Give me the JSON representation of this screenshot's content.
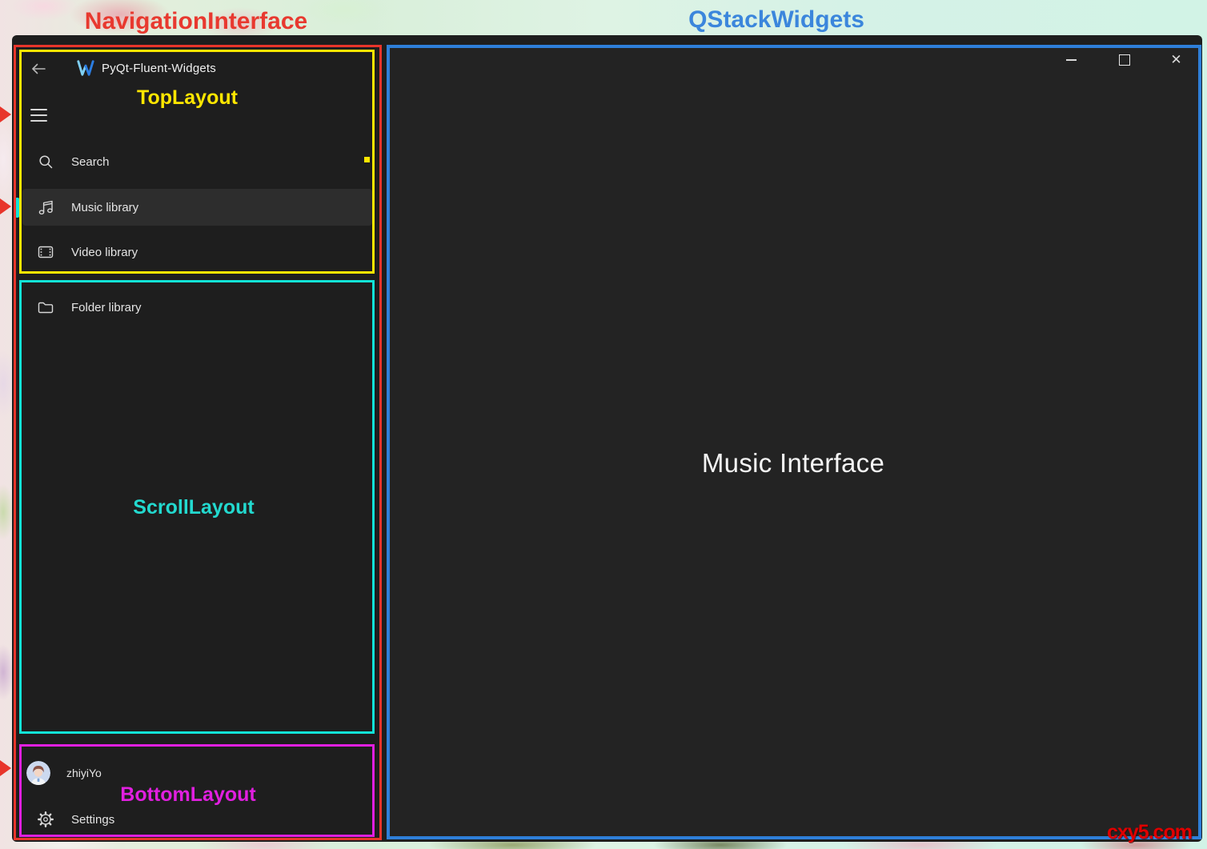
{
  "annotations": {
    "navigation_interface": "NavigationInterface",
    "qstack_widgets": "QStackWidgets",
    "top_layout": "TopLayout",
    "scroll_layout": "ScrollLayout",
    "bottom_layout": "BottomLayout",
    "colors": {
      "red": "#e8352b",
      "yellow": "#ffe600",
      "cyan": "#12e3d7",
      "magenta": "#e11fe0",
      "blue_border": "#2e7fd9",
      "blue_label": "#3b86dc"
    }
  },
  "window": {
    "app_title": "PyQt-Fluent-Widgets",
    "controls": [
      {
        "name": "minimize"
      },
      {
        "name": "maximize"
      },
      {
        "name": "close",
        "glyph": "✕"
      }
    ]
  },
  "sidebar": {
    "items": [
      {
        "label": "Search",
        "icon": "search-icon",
        "selected": false
      },
      {
        "label": "Music library",
        "icon": "music-note-icon",
        "selected": true
      },
      {
        "label": "Video library",
        "icon": "film-icon",
        "selected": false
      },
      {
        "label": "Folder library",
        "icon": "folder-icon",
        "selected": false
      }
    ],
    "user": {
      "name": "zhiyiYo"
    },
    "settings": {
      "label": "Settings"
    }
  },
  "stack": {
    "page_title": "Music Interface"
  },
  "watermark": "cxy5.com"
}
